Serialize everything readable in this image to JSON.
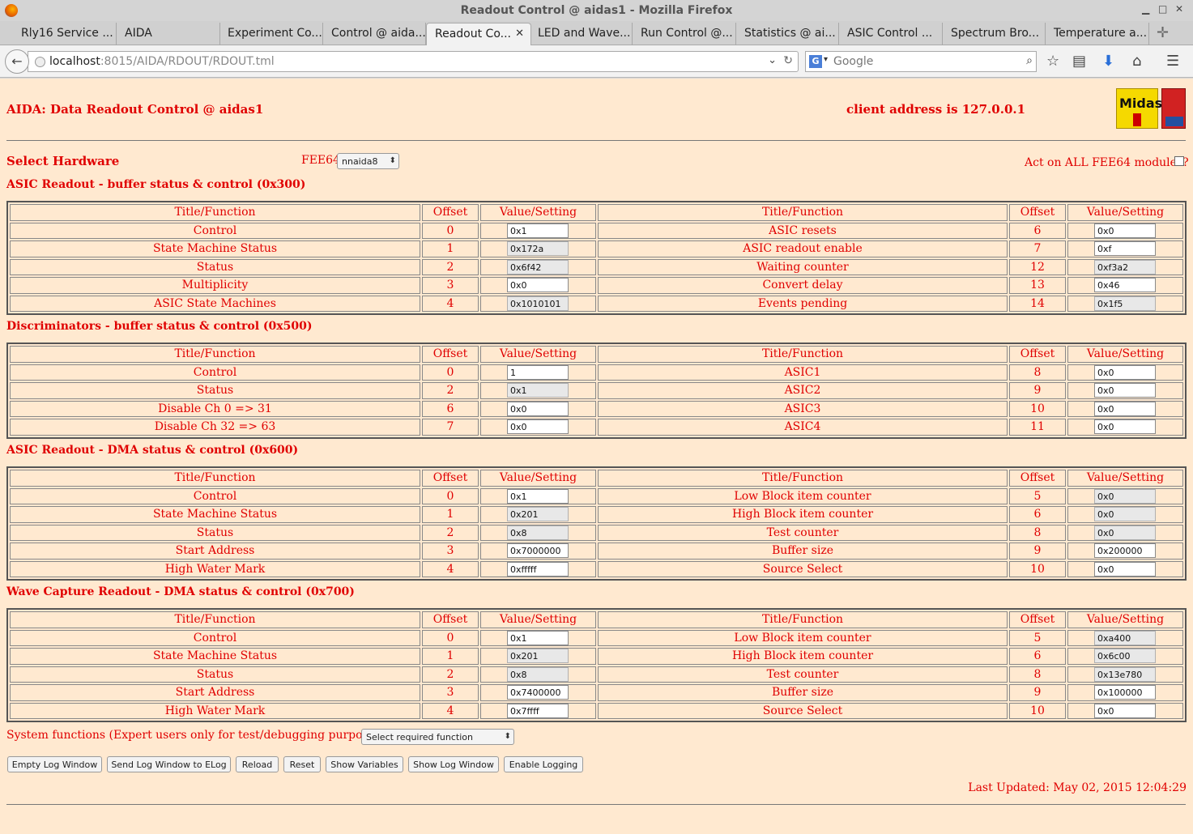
{
  "window": {
    "title": "Readout Control @ aidas1 - Mozilla Firefox"
  },
  "tabs": [
    {
      "label": "Rly16 Service ..."
    },
    {
      "label": "AIDA"
    },
    {
      "label": "Experiment Co..."
    },
    {
      "label": "Control @ aida..."
    },
    {
      "label": "Readout Co..."
    },
    {
      "label": "LED and Wave..."
    },
    {
      "label": "Run Control @..."
    },
    {
      "label": "Statistics @ ai..."
    },
    {
      "label": "ASIC Control ..."
    },
    {
      "label": "Spectrum Bro..."
    },
    {
      "label": "Temperature a..."
    }
  ],
  "nav": {
    "url_host": "localhost",
    "url_rest": ":8015/AIDA/RDOUT/RDOUT.tml",
    "search_placeholder": "Google",
    "search_engine": "G"
  },
  "page": {
    "title": "AIDA: Data Readout Control @ aidas1",
    "client": "client address is 127.0.0.1",
    "logo_text": "Midas",
    "select_hw_label": "Select Hardware",
    "fee_label": "FEE64",
    "fee_value": "nnaida8",
    "act_all_label": "Act on ALL FEE64 modules?",
    "act_all_checked": false
  },
  "col_headers": {
    "title": "Title/Function",
    "offset": "Offset",
    "value": "Value/Setting"
  },
  "sections": [
    {
      "heading": "ASIC Readout - buffer status & control (0x300)",
      "rows": [
        {
          "l_title": "Control",
          "l_off": "0",
          "l_val": "0x1",
          "l_ro": false,
          "r_title": "ASIC resets",
          "r_off": "6",
          "r_val": "0x0",
          "r_ro": false
        },
        {
          "l_title": "State Machine Status",
          "l_off": "1",
          "l_val": "0x172a",
          "l_ro": true,
          "r_title": "ASIC readout enable",
          "r_off": "7",
          "r_val": "0xf",
          "r_ro": false
        },
        {
          "l_title": "Status",
          "l_off": "2",
          "l_val": "0x6f42",
          "l_ro": true,
          "r_title": "Waiting counter",
          "r_off": "12",
          "r_val": "0xf3a2",
          "r_ro": true
        },
        {
          "l_title": "Multiplicity",
          "l_off": "3",
          "l_val": "0x0",
          "l_ro": false,
          "r_title": "Convert delay",
          "r_off": "13",
          "r_val": "0x46",
          "r_ro": false
        },
        {
          "l_title": "ASIC State Machines",
          "l_off": "4",
          "l_val": "0x1010101",
          "l_ro": true,
          "r_title": "Events pending",
          "r_off": "14",
          "r_val": "0x1f5",
          "r_ro": true
        }
      ]
    },
    {
      "heading": "Discriminators - buffer status & control (0x500)",
      "rows": [
        {
          "l_title": "Control",
          "l_off": "0",
          "l_val": "1",
          "l_ro": false,
          "r_title": "ASIC1",
          "r_off": "8",
          "r_val": "0x0",
          "r_ro": false
        },
        {
          "l_title": "Status",
          "l_off": "2",
          "l_val": "0x1",
          "l_ro": true,
          "r_title": "ASIC2",
          "r_off": "9",
          "r_val": "0x0",
          "r_ro": false
        },
        {
          "l_title": "Disable Ch 0 => 31",
          "l_off": "6",
          "l_val": "0x0",
          "l_ro": false,
          "r_title": "ASIC3",
          "r_off": "10",
          "r_val": "0x0",
          "r_ro": false
        },
        {
          "l_title": "Disable Ch 32 => 63",
          "l_off": "7",
          "l_val": "0x0",
          "l_ro": false,
          "r_title": "ASIC4",
          "r_off": "11",
          "r_val": "0x0",
          "r_ro": false
        }
      ]
    },
    {
      "heading": "ASIC Readout - DMA status & control (0x600)",
      "rows": [
        {
          "l_title": "Control",
          "l_off": "0",
          "l_val": "0x1",
          "l_ro": false,
          "r_title": "Low Block item counter",
          "r_off": "5",
          "r_val": "0x0",
          "r_ro": true
        },
        {
          "l_title": "State Machine Status",
          "l_off": "1",
          "l_val": "0x201",
          "l_ro": true,
          "r_title": "High Block item counter",
          "r_off": "6",
          "r_val": "0x0",
          "r_ro": true
        },
        {
          "l_title": "Status",
          "l_off": "2",
          "l_val": "0x8",
          "l_ro": true,
          "r_title": "Test counter",
          "r_off": "8",
          "r_val": "0x0",
          "r_ro": true
        },
        {
          "l_title": "Start Address",
          "l_off": "3",
          "l_val": "0x7000000",
          "l_ro": false,
          "r_title": "Buffer size",
          "r_off": "9",
          "r_val": "0x200000",
          "r_ro": false
        },
        {
          "l_title": "High Water Mark",
          "l_off": "4",
          "l_val": "0xfffff",
          "l_ro": false,
          "r_title": "Source Select",
          "r_off": "10",
          "r_val": "0x0",
          "r_ro": false
        }
      ]
    },
    {
      "heading": "Wave Capture Readout - DMA status & control (0x700)",
      "rows": [
        {
          "l_title": "Control",
          "l_off": "0",
          "l_val": "0x1",
          "l_ro": false,
          "r_title": "Low Block item counter",
          "r_off": "5",
          "r_val": "0xa400",
          "r_ro": true
        },
        {
          "l_title": "State Machine Status",
          "l_off": "1",
          "l_val": "0x201",
          "l_ro": true,
          "r_title": "High Block item counter",
          "r_off": "6",
          "r_val": "0x6c00",
          "r_ro": true
        },
        {
          "l_title": "Status",
          "l_off": "2",
          "l_val": "0x8",
          "l_ro": true,
          "r_title": "Test counter",
          "r_off": "8",
          "r_val": "0x13e780",
          "r_ro": true
        },
        {
          "l_title": "Start Address",
          "l_off": "3",
          "l_val": "0x7400000",
          "l_ro": false,
          "r_title": "Buffer size",
          "r_off": "9",
          "r_val": "0x100000",
          "r_ro": false
        },
        {
          "l_title": "High Water Mark",
          "l_off": "4",
          "l_val": "0x7ffff",
          "l_ro": false,
          "r_title": "Source Select",
          "r_off": "10",
          "r_val": "0x0",
          "r_ro": false
        }
      ]
    }
  ],
  "system": {
    "label": "System functions (Expert users only for test/debugging purposes!!!)",
    "select_value": "Select required function"
  },
  "buttons": [
    {
      "label": "Empty Log Window",
      "name": "empty-log-window-button"
    },
    {
      "label": "Send Log Window to ELog",
      "name": "send-log-to-elog-button"
    },
    {
      "label": "Reload",
      "name": "reload-button"
    },
    {
      "label": "Reset",
      "name": "reset-button"
    },
    {
      "label": "Show Variables",
      "name": "show-variables-button"
    },
    {
      "label": "Show Log Window",
      "name": "show-log-window-button"
    },
    {
      "label": "Enable Logging",
      "name": "enable-logging-button"
    }
  ],
  "footer": {
    "last_updated": "Last Updated: May 02, 2015 12:04:29"
  }
}
